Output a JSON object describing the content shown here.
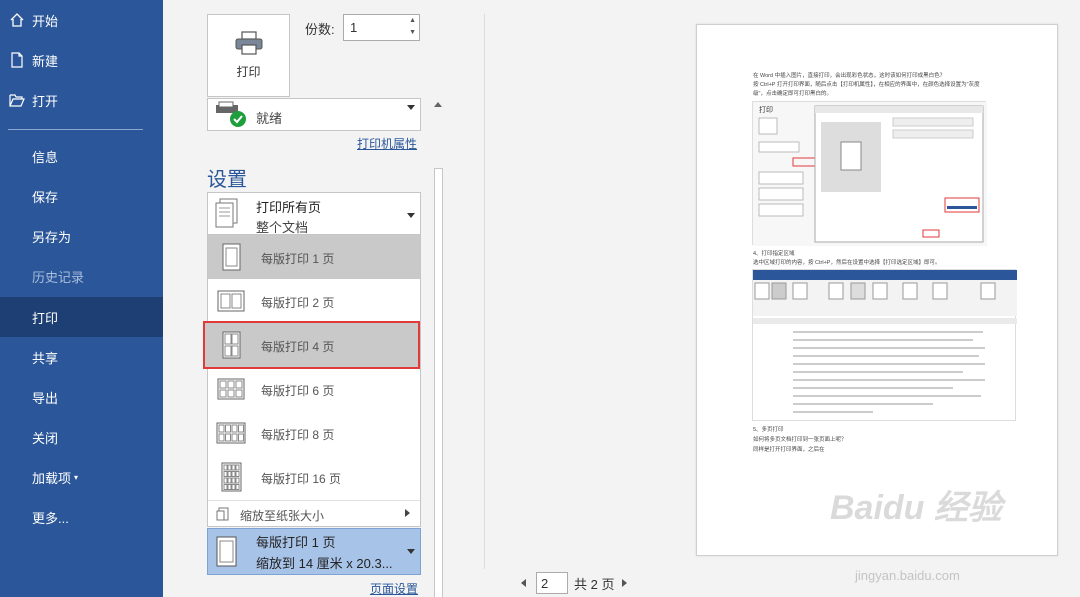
{
  "nav": {
    "top_items": [
      {
        "label": "开始",
        "icon": "home-icon"
      },
      {
        "label": "新建",
        "icon": "new-document-icon"
      },
      {
        "label": "打开",
        "icon": "open-folder-icon"
      }
    ],
    "items": [
      {
        "label": "信息",
        "active": false,
        "dim": false
      },
      {
        "label": "保存",
        "active": false,
        "dim": false
      },
      {
        "label": "另存为",
        "active": false,
        "dim": false
      },
      {
        "label": "历史记录",
        "active": false,
        "dim": true
      },
      {
        "label": "打印",
        "active": true,
        "dim": false
      },
      {
        "label": "共享",
        "active": false,
        "dim": false
      },
      {
        "label": "导出",
        "active": false,
        "dim": false
      },
      {
        "label": "关闭",
        "active": false,
        "dim": false
      },
      {
        "label": "加载项",
        "active": false,
        "dim": false
      },
      {
        "label": "更多...",
        "active": false,
        "dim": false
      }
    ]
  },
  "print": {
    "print_button": "打印",
    "copies_label": "份数:",
    "copies_value": "1",
    "printer_status": "就绪",
    "printer_properties": "打印机属性",
    "settings_title": "设置",
    "range_main": "打印所有页",
    "range_sub": "整个文档",
    "options": [
      {
        "label": "每版打印 1 页",
        "pages": 1
      },
      {
        "label": "每版打印 2 页",
        "pages": 2
      },
      {
        "label": "每版打印 4 页",
        "pages": 4
      },
      {
        "label": "每版打印 6 页",
        "pages": 6
      },
      {
        "label": "每版打印 8 页",
        "pages": 8
      },
      {
        "label": "每版打印 16 页",
        "pages": 16
      }
    ],
    "fit_paper": "缩放至纸张大小",
    "pps_main": "每版打印 1 页",
    "pps_sub": "缩放到 14 厘米 x 20.3...",
    "page_setup": "页面设置"
  },
  "preview": {
    "current_page": "2",
    "total_pages": "共 2 页",
    "lines_top": [
      "在 Word 中插入图片，直接打印，会出现彩色状态，这时该如何打印成黑白色？",
      "按 Ctrl+P 打开打印界面，随后点击【打印机属性】，在相应的界面中，在颜色选择设置为\"灰度",
      "级\"，点击确定即可打印黑白的。"
    ],
    "section4": "4、打印指定区域",
    "section4_desc": "选中区域打印的内容，按 Ctrl+P，然后在设置中选择【打印选定区域】即可。",
    "section5": "5、多页打印",
    "section5_q": "如何将多页文档打印到一张页面上呢？",
    "section5_a": "同样是打开打印界面，之后在",
    "watermark": "Baidu 经验",
    "watermark_url": "jingyan.baidu.com"
  }
}
